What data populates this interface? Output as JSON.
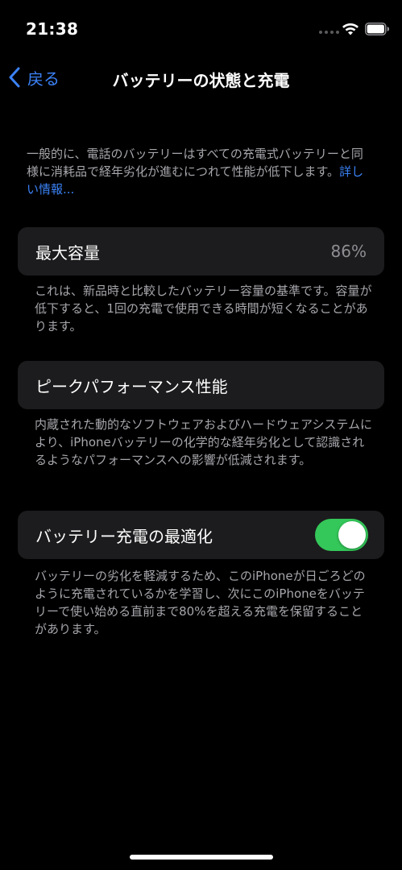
{
  "status_bar": {
    "time": "21:38",
    "icons": [
      "signal-dots-icon",
      "wifi-icon",
      "battery-icon"
    ]
  },
  "nav": {
    "back_label": "戻る",
    "title": "バッテリーの状態と充電"
  },
  "intro": {
    "text": "一般的に、電話のバッテリーはすべての充電式バッテリーと同様に消耗品で経年劣化が進むにつれて性能が低下します。",
    "link": "詳しい情報..."
  },
  "max_capacity": {
    "label": "最大容量",
    "value": "86%",
    "footnote": "これは、新品時と比較したバッテリー容量の基準です。容量が低下すると、1回の充電で使用できる時間が短くなることがあります。"
  },
  "peak_performance": {
    "label": "ピークパフォーマンス性能",
    "footnote": "内蔵された動的なソフトウェアおよびハードウェアシステムにより、iPhoneバッテリーの化学的な経年劣化として認識されるようなパフォーマンスへの影響が低減されます。"
  },
  "optimized_charging": {
    "label": "バッテリー充電の最適化",
    "enabled": true,
    "footnote": "バッテリーの劣化を軽減するため、このiPhoneが日ごろどのように充電されているかを学習し、次にこのiPhoneをバッテリーで使い始める直前まで80%を超える充電を保留することがあります。"
  },
  "colors": {
    "background": "#000000",
    "card": "#1c1c1e",
    "accent": "#3b82f6",
    "toggle_on": "#34c759",
    "secondary_text": "#a6a6ac"
  }
}
